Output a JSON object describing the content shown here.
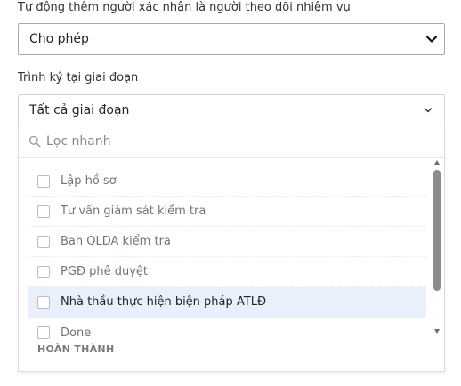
{
  "auto_add": {
    "label": "Tự động thêm người xác nhận là người theo dõi nhiệm vụ",
    "selected": "Cho phép"
  },
  "signer_stage": {
    "label": "Trình ký tại giai đoạn",
    "selected": "Tất cả giai đoạn",
    "search_placeholder": "Lọc nhanh",
    "options": [
      {
        "label": "Lập hồ sơ",
        "checked": false
      },
      {
        "label": "Tư vấn giám sát kiểm tra",
        "checked": false
      },
      {
        "label": "Ban QLDA kiểm tra",
        "checked": false
      },
      {
        "label": "PGĐ phê duyệt",
        "checked": false
      },
      {
        "label": "Nhà thầu thực hiện biện pháp ATLĐ",
        "checked": false,
        "highlighted": true
      },
      {
        "label": "Done",
        "checked": false
      }
    ],
    "group_label": "HOÀN THÀNH"
  },
  "icons": {
    "select_arrow": "chevron-down-icon",
    "search": "search-icon",
    "checkbox": "checkbox-icon"
  },
  "colors": {
    "highlight": "#e8f0fb",
    "border": "#ced4da",
    "muted_text": "#6c757d"
  }
}
